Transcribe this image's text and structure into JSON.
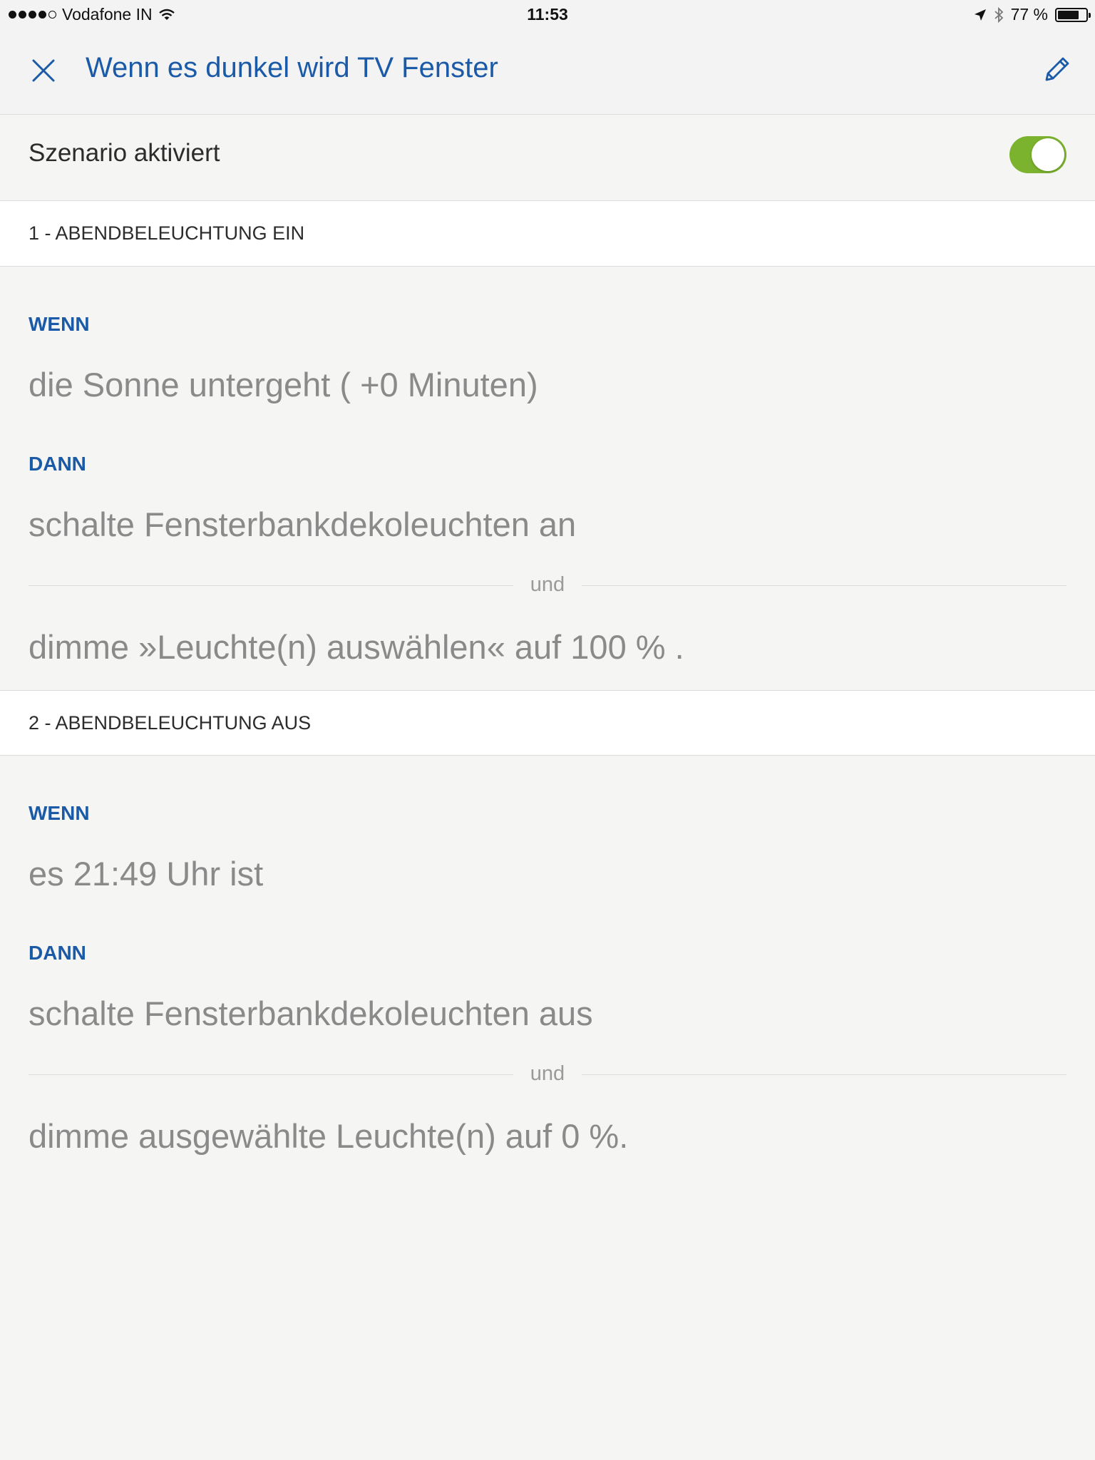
{
  "status_bar": {
    "carrier": "Vodafone IN",
    "time": "11:53",
    "battery": "77 %",
    "battery_level": 0.77
  },
  "nav": {
    "title": "Wenn es dunkel wird TV Fenster"
  },
  "toggle": {
    "label": "Szenario aktiviert",
    "on": true,
    "color": "#7cb32e"
  },
  "rules": [
    {
      "header": "1 - ABENDBELEUCHTUNG EIN",
      "when_label": "WENN",
      "when_text": "die Sonne untergeht ( +0 Minuten)",
      "then_label": "DANN",
      "actions": [
        "schalte Fensterbankdekoleuchten an",
        "dimme »Leuchte(n) auswählen« auf 100 % ."
      ],
      "connector": "und"
    },
    {
      "header": "2 - ABENDBELEUCHTUNG AUS",
      "when_label": "WENN",
      "when_text": "es 21:49 Uhr ist",
      "then_label": "DANN",
      "actions": [
        "schalte Fensterbankdekoleuchten aus",
        "dimme ausgewählte Leuchte(n) auf 0 %."
      ],
      "connector": "und"
    }
  ],
  "colors": {
    "accent": "#1a5aa6",
    "background": "#f5f5f4"
  }
}
